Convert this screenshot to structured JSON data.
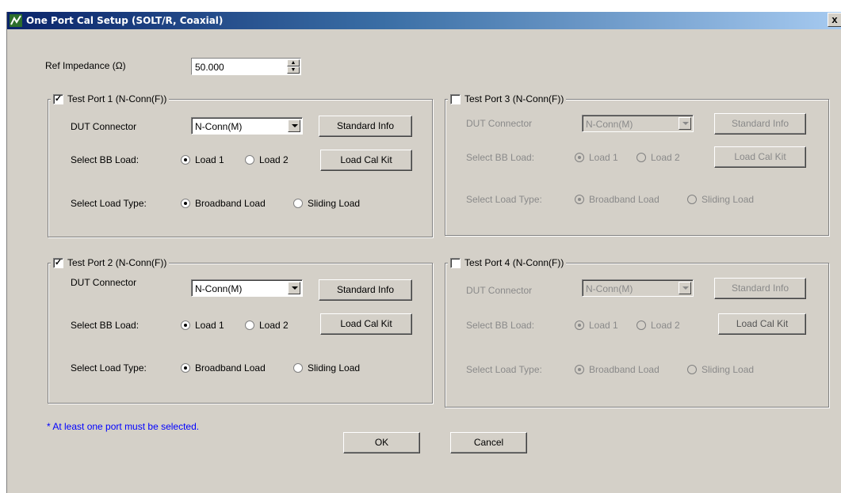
{
  "window": {
    "title": "One Port Cal Setup (SOLT/R, Coaxial)",
    "close_glyph": "x"
  },
  "ref_impedance": {
    "label": "Ref Impedance (Ω)",
    "value": "50.000"
  },
  "labels": {
    "dut_connector": "DUT Connector",
    "select_bb_load": "Select BB Load:",
    "select_load_type": "Select Load Type:",
    "load1": "Load 1",
    "load2": "Load 2",
    "broadband": "Broadband Load",
    "sliding": "Sliding Load",
    "standard_info": "Standard Info",
    "load_cal_kit": "Load Cal Kit",
    "connector_value": "N-Conn(M)"
  },
  "ports": {
    "p1": {
      "title": "Test Port 1 (N-Conn(F))",
      "checked": true,
      "check_glyph": "✓"
    },
    "p2": {
      "title": "Test Port 2 (N-Conn(F))",
      "checked": true,
      "check_glyph": "✓"
    },
    "p3": {
      "title": "Test Port 3 (N-Conn(F))",
      "checked": false
    },
    "p4": {
      "title": "Test Port 4 (N-Conn(F))",
      "checked": false
    }
  },
  "note": "* At least one port must be selected.",
  "buttons": {
    "ok": "OK",
    "cancel": "Cancel"
  },
  "colors": {
    "dialog_bg": "#d4d0c8",
    "title_gradient_start": "#0a246a",
    "note_text": "#0000ff",
    "disabled_text": "#8a8a8a"
  }
}
